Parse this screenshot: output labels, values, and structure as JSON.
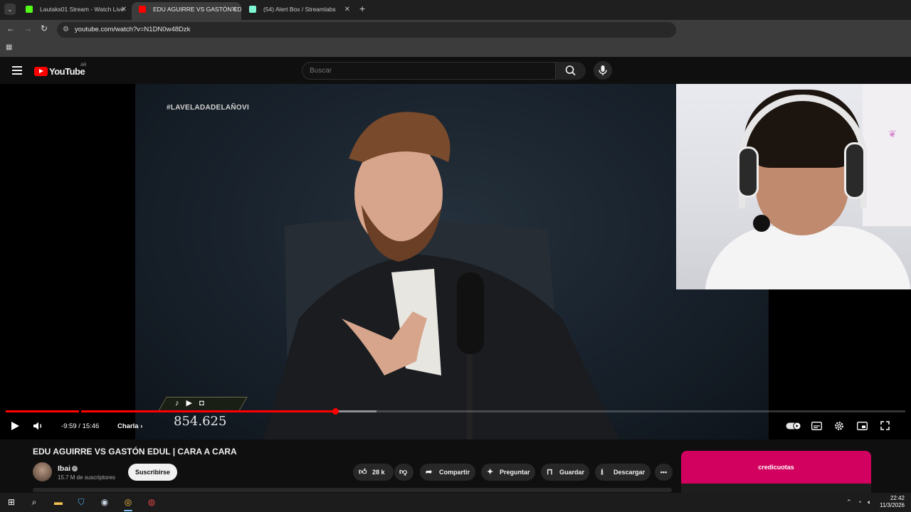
{
  "browser": {
    "tabs": [
      {
        "title": "Lautaks01 Stream - Watch Live",
        "favicon_color": "#53fc18",
        "active": false
      },
      {
        "title": "EDU AGUIRRE VS GASTÓN EDUL",
        "favicon_color": "#ff0000",
        "active": true
      },
      {
        "title": "(54) Alert Box / Streamlabs",
        "favicon_color": "#80f5d2",
        "active": false
      }
    ],
    "url": "youtube.com/watch?v=N1DN0w48Dzk"
  },
  "youtube": {
    "logo_text": "YouTube",
    "country_code": "AR",
    "search_placeholder": "Buscar"
  },
  "player": {
    "overlay_hashtag": "#LAVELADADELAÑOVI",
    "overlay_count": "854.625",
    "time_display": "-9:59 / 15:46",
    "chapter": "Charla",
    "progress_played_fraction": 0.366,
    "progress_loaded_fraction": 0.412
  },
  "video": {
    "title": "EDU AGUIRRE VS GASTÓN EDUL | CARA A CARA",
    "channel_name": "Ibai",
    "subscribers": "15.7 M de suscriptores",
    "subscribe_label": "Suscribirse",
    "likes": "28 k",
    "share_label": "Compartir",
    "ask_label": "Preguntar",
    "save_label": "Guardar",
    "download_label": "Descargar"
  },
  "side_card": {
    "title": "credicuotas"
  },
  "taskbar": {
    "time": "22:42",
    "date": "11/3/2026"
  },
  "colors": {
    "accent_red": "#ff0000",
    "side_card_pink": "#d2005e"
  }
}
